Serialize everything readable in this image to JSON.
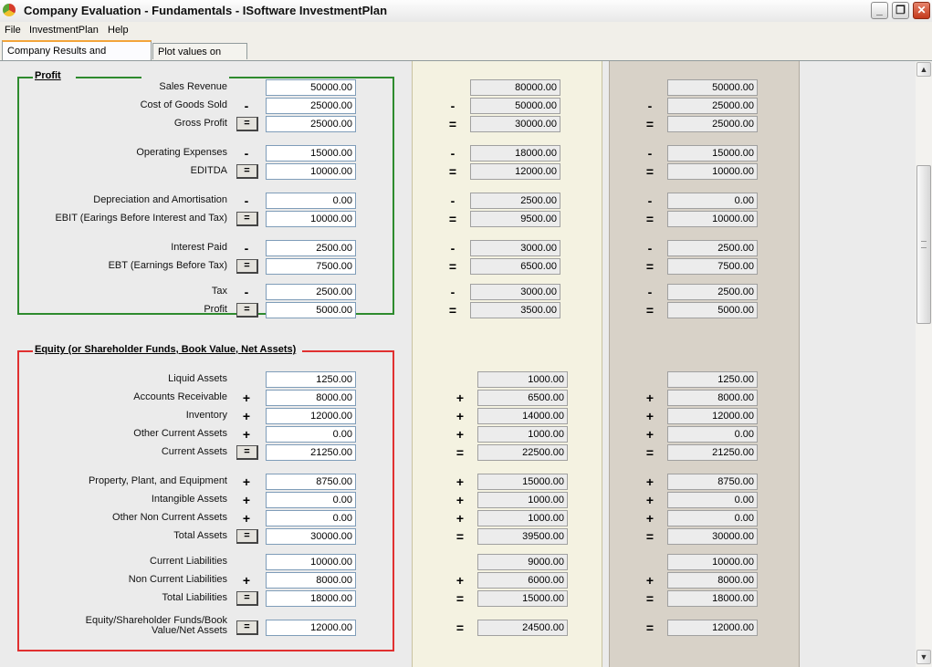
{
  "window": {
    "title": "Company Evaluation - Fundamentals - ISoftware InvestmentPlan",
    "buttons": {
      "minimize": "_",
      "restore": "❐",
      "close": "✕"
    }
  },
  "menu": {
    "file": "File",
    "investmentplan": "InvestmentPlan",
    "help": "Help"
  },
  "tabs": {
    "results": "Company Results and Measures",
    "plot": "Plot values on Chart"
  },
  "groups": {
    "profit": "Profit",
    "equity": "Equity (or Shareholder Funds, Book Value, Net Assets)"
  },
  "eq_button": "=",
  "scroll": {
    "up": "▲",
    "down": "▼"
  },
  "profit_rows": [
    {
      "label": "Sales Revenue",
      "op": "",
      "c1": "50000.00",
      "c2": "80000.00",
      "c3": "50000.00"
    },
    {
      "label": "Cost of Goods Sold",
      "op": "-",
      "c1": "25000.00",
      "c2": "50000.00",
      "c3": "25000.00"
    },
    {
      "label": "Gross Profit",
      "op": "=",
      "c1": "25000.00",
      "c2": "30000.00",
      "c3": "25000.00"
    },
    {
      "label": "Operating Expenses",
      "op": "-",
      "c1": "15000.00",
      "c2": "18000.00",
      "c3": "15000.00"
    },
    {
      "label": "EDITDA",
      "op": "=",
      "c1": "10000.00",
      "c2": "12000.00",
      "c3": "10000.00"
    },
    {
      "label": "Depreciation and Amortisation",
      "op": "-",
      "c1": "0.00",
      "c2": "2500.00",
      "c3": "0.00"
    },
    {
      "label": "EBIT (Earings Before Interest and Tax)",
      "op": "=",
      "c1": "10000.00",
      "c2": "9500.00",
      "c3": "10000.00"
    },
    {
      "label": "Interest Paid",
      "op": "-",
      "c1": "2500.00",
      "c2": "3000.00",
      "c3": "2500.00"
    },
    {
      "label": "EBT (Earnings Before Tax)",
      "op": "=",
      "c1": "7500.00",
      "c2": "6500.00",
      "c3": "7500.00"
    },
    {
      "label": "Tax",
      "op": "-",
      "c1": "2500.00",
      "c2": "3000.00",
      "c3": "2500.00"
    },
    {
      "label": "Profit",
      "op": "=",
      "c1": "5000.00",
      "c2": "3500.00",
      "c3": "5000.00"
    }
  ],
  "equity_rows": [
    {
      "label": "Liquid Assets",
      "op": "",
      "c1": "1250.00",
      "c2": "1000.00",
      "c3": "1250.00"
    },
    {
      "label": "Accounts Receivable",
      "op": "+",
      "c1": "8000.00",
      "c2": "6500.00",
      "c3": "8000.00"
    },
    {
      "label": "Inventory",
      "op": "+",
      "c1": "12000.00",
      "c2": "14000.00",
      "c3": "12000.00"
    },
    {
      "label": "Other Current Assets",
      "op": "+",
      "c1": "0.00",
      "c2": "1000.00",
      "c3": "0.00"
    },
    {
      "label": "Current Assets",
      "op": "=",
      "c1": "21250.00",
      "c2": "22500.00",
      "c3": "21250.00"
    },
    {
      "label": "Property, Plant, and Equipment",
      "op": "+",
      "c1": "8750.00",
      "c2": "15000.00",
      "c3": "8750.00"
    },
    {
      "label": "Intangible Assets",
      "op": "+",
      "c1": "0.00",
      "c2": "1000.00",
      "c3": "0.00"
    },
    {
      "label": "Other Non Current Assets",
      "op": "+",
      "c1": "0.00",
      "c2": "1000.00",
      "c3": "0.00"
    },
    {
      "label": "Total Assets",
      "op": "=",
      "c1": "30000.00",
      "c2": "39500.00",
      "c3": "30000.00"
    },
    {
      "label": "Current Liabilities",
      "op": "",
      "c1": "10000.00",
      "c2": "9000.00",
      "c3": "10000.00"
    },
    {
      "label": "Non Current Liabilities",
      "op": "+",
      "c1": "8000.00",
      "c2": "6000.00",
      "c3": "8000.00"
    },
    {
      "label": "Total Liabilities",
      "op": "=",
      "c1": "18000.00",
      "c2": "15000.00",
      "c3": "18000.00"
    },
    {
      "label": "Equity/Shareholder Funds/Book Value/Net Assets",
      "op": "=",
      "c1": "12000.00",
      "c2": "24500.00",
      "c3": "12000.00"
    }
  ]
}
